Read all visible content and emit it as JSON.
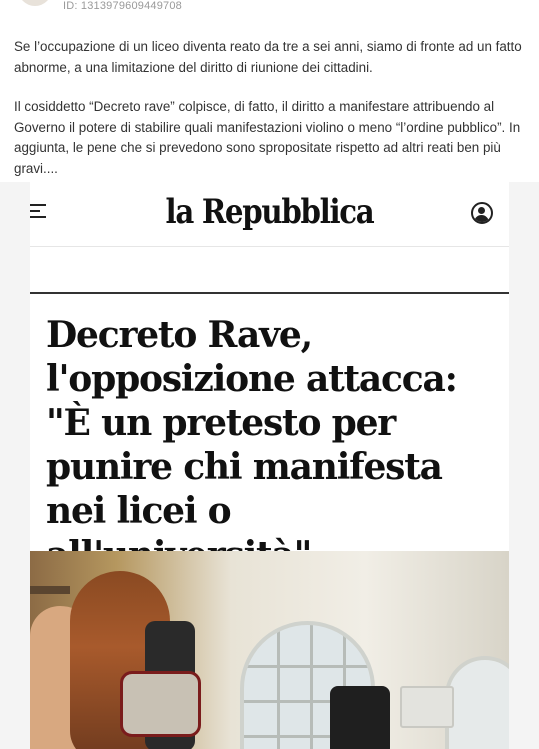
{
  "post": {
    "id_text": "ID: 1313979609449708",
    "paragraph1": "Se l’occupazione di un liceo diventa reato da tre a sei anni, siamo di fronte ad un fatto abnorme, a una limitazione del diritto di riunione dei cittadini.",
    "paragraph2": "Il cosiddetto “Decreto rave” colpisce, di fatto, il diritto a manifestare attribuendo al Governo il potere di stabilire quali manifestazioni violino o meno “l’ordine pubblico”. In aggiunta, le pene che si prevedono sono spropositate rispetto ad altri reati ben più gravi...."
  },
  "article": {
    "logo": "la Repubblica",
    "headline": "Decreto Rave, l'opposizione attacca: \"È un pretesto per punire chi manifesta nei licei o all'università\"",
    "menu_icon": "hamburger-menu-icon",
    "user_icon": "user-account-icon"
  }
}
